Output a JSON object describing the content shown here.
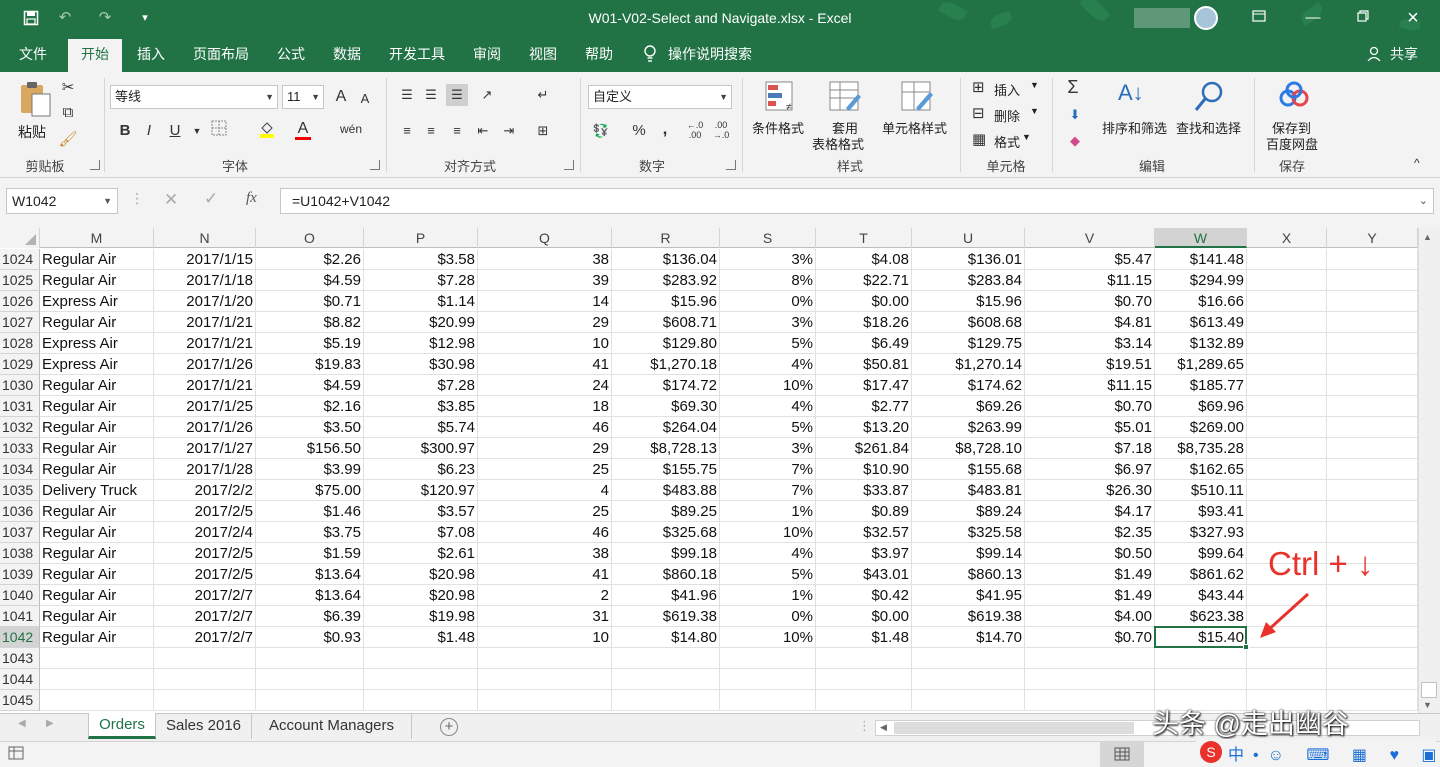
{
  "titlebar": {
    "doc_title": "W01-V02-Select and Navigate.xlsx  -  Excel",
    "save_icon": "save-icon",
    "undo_icon": "undo-icon",
    "redo_icon": "redo-icon",
    "restore_icon": "restore-icon"
  },
  "ribbon_tabs": [
    "文件",
    "开始",
    "插入",
    "页面布局",
    "公式",
    "数据",
    "开发工具",
    "审阅",
    "视图",
    "帮助",
    "操作说明搜索"
  ],
  "share_label": "共享",
  "clipboard": {
    "paste": "粘贴",
    "group": "剪贴板"
  },
  "font": {
    "name": "等线",
    "size": "11",
    "group": "字体",
    "bold": "B",
    "italic": "I",
    "underline": "U",
    "grow": "A",
    "shrink": "A"
  },
  "alignment": {
    "group": "对齐方式"
  },
  "number": {
    "format": "自定义",
    "group": "数字",
    "percent": "%",
    "comma": ","
  },
  "styles": {
    "conditional": "条件格式",
    "table_line1": "套用",
    "table_line2": "表格格式",
    "cell_styles": "单元格样式",
    "group": "样式"
  },
  "cells": {
    "insert": "插入",
    "delete": "删除",
    "format": "格式",
    "group": "单元格"
  },
  "editing": {
    "sort": "排序和筛选",
    "find": "查找和选择",
    "group": "编辑",
    "sum": "Σ"
  },
  "save_group": {
    "line1": "保存到",
    "line2": "百度网盘",
    "group": "保存"
  },
  "formula_bar": {
    "name_box": "W1042",
    "formula": "=U1042+V1042",
    "fx": "fx"
  },
  "columns": [
    "M",
    "N",
    "O",
    "P",
    "Q",
    "R",
    "S",
    "T",
    "U",
    "V",
    "W",
    "X",
    "Y"
  ],
  "rows": [
    {
      "num": "1024",
      "M": "Regular Air",
      "N": "2017/1/15",
      "O": "$2.26",
      "P": "$3.58",
      "Q": "38",
      "R": "$136.04",
      "S": "3%",
      "T": "$4.08",
      "U": "$136.01",
      "V": "$5.47",
      "W": "$141.48"
    },
    {
      "num": "1025",
      "M": "Regular Air",
      "N": "2017/1/18",
      "O": "$4.59",
      "P": "$7.28",
      "Q": "39",
      "R": "$283.92",
      "S": "8%",
      "T": "$22.71",
      "U": "$283.84",
      "V": "$11.15",
      "W": "$294.99"
    },
    {
      "num": "1026",
      "M": "Express Air",
      "N": "2017/1/20",
      "O": "$0.71",
      "P": "$1.14",
      "Q": "14",
      "R": "$15.96",
      "S": "0%",
      "T": "$0.00",
      "U": "$15.96",
      "V": "$0.70",
      "W": "$16.66"
    },
    {
      "num": "1027",
      "M": "Regular Air",
      "N": "2017/1/21",
      "O": "$8.82",
      "P": "$20.99",
      "Q": "29",
      "R": "$608.71",
      "S": "3%",
      "T": "$18.26",
      "U": "$608.68",
      "V": "$4.81",
      "W": "$613.49"
    },
    {
      "num": "1028",
      "M": "Express Air",
      "N": "2017/1/21",
      "O": "$5.19",
      "P": "$12.98",
      "Q": "10",
      "R": "$129.80",
      "S": "5%",
      "T": "$6.49",
      "U": "$129.75",
      "V": "$3.14",
      "W": "$132.89"
    },
    {
      "num": "1029",
      "M": "Express Air",
      "N": "2017/1/26",
      "O": "$19.83",
      "P": "$30.98",
      "Q": "41",
      "R": "$1,270.18",
      "S": "4%",
      "T": "$50.81",
      "U": "$1,270.14",
      "V": "$19.51",
      "W": "$1,289.65"
    },
    {
      "num": "1030",
      "M": "Regular Air",
      "N": "2017/1/21",
      "O": "$4.59",
      "P": "$7.28",
      "Q": "24",
      "R": "$174.72",
      "S": "10%",
      "T": "$17.47",
      "U": "$174.62",
      "V": "$11.15",
      "W": "$185.77"
    },
    {
      "num": "1031",
      "M": "Regular Air",
      "N": "2017/1/25",
      "O": "$2.16",
      "P": "$3.85",
      "Q": "18",
      "R": "$69.30",
      "S": "4%",
      "T": "$2.77",
      "U": "$69.26",
      "V": "$0.70",
      "W": "$69.96"
    },
    {
      "num": "1032",
      "M": "Regular Air",
      "N": "2017/1/26",
      "O": "$3.50",
      "P": "$5.74",
      "Q": "46",
      "R": "$264.04",
      "S": "5%",
      "T": "$13.20",
      "U": "$263.99",
      "V": "$5.01",
      "W": "$269.00"
    },
    {
      "num": "1033",
      "M": "Regular Air",
      "N": "2017/1/27",
      "O": "$156.50",
      "P": "$300.97",
      "Q": "29",
      "R": "$8,728.13",
      "S": "3%",
      "T": "$261.84",
      "U": "$8,728.10",
      "V": "$7.18",
      "W": "$8,735.28"
    },
    {
      "num": "1034",
      "M": "Regular Air",
      "N": "2017/1/28",
      "O": "$3.99",
      "P": "$6.23",
      "Q": "25",
      "R": "$155.75",
      "S": "7%",
      "T": "$10.90",
      "U": "$155.68",
      "V": "$6.97",
      "W": "$162.65"
    },
    {
      "num": "1035",
      "M": "Delivery Truck",
      "N": "2017/2/2",
      "O": "$75.00",
      "P": "$120.97",
      "Q": "4",
      "R": "$483.88",
      "S": "7%",
      "T": "$33.87",
      "U": "$483.81",
      "V": "$26.30",
      "W": "$510.11"
    },
    {
      "num": "1036",
      "M": "Regular Air",
      "N": "2017/2/5",
      "O": "$1.46",
      "P": "$3.57",
      "Q": "25",
      "R": "$89.25",
      "S": "1%",
      "T": "$0.89",
      "U": "$89.24",
      "V": "$4.17",
      "W": "$93.41"
    },
    {
      "num": "1037",
      "M": "Regular Air",
      "N": "2017/2/4",
      "O": "$3.75",
      "P": "$7.08",
      "Q": "46",
      "R": "$325.68",
      "S": "10%",
      "T": "$32.57",
      "U": "$325.58",
      "V": "$2.35",
      "W": "$327.93"
    },
    {
      "num": "1038",
      "M": "Regular Air",
      "N": "2017/2/5",
      "O": "$1.59",
      "P": "$2.61",
      "Q": "38",
      "R": "$99.18",
      "S": "4%",
      "T": "$3.97",
      "U": "$99.14",
      "V": "$0.50",
      "W": "$99.64"
    },
    {
      "num": "1039",
      "M": "Regular Air",
      "N": "2017/2/5",
      "O": "$13.64",
      "P": "$20.98",
      "Q": "41",
      "R": "$860.18",
      "S": "5%",
      "T": "$43.01",
      "U": "$860.13",
      "V": "$1.49",
      "W": "$861.62"
    },
    {
      "num": "1040",
      "M": "Regular Air",
      "N": "2017/2/7",
      "O": "$13.64",
      "P": "$20.98",
      "Q": "2",
      "R": "$41.96",
      "S": "1%",
      "T": "$0.42",
      "U": "$41.95",
      "V": "$1.49",
      "W": "$43.44"
    },
    {
      "num": "1041",
      "M": "Regular Air",
      "N": "2017/2/7",
      "O": "$6.39",
      "P": "$19.98",
      "Q": "31",
      "R": "$619.38",
      "S": "0%",
      "T": "$0.00",
      "U": "$619.38",
      "V": "$4.00",
      "W": "$623.38"
    },
    {
      "num": "1042",
      "M": "Regular Air",
      "N": "2017/2/7",
      "O": "$0.93",
      "P": "$1.48",
      "Q": "10",
      "R": "$14.80",
      "S": "10%",
      "T": "$1.48",
      "U": "$14.70",
      "V": "$0.70",
      "W": "$15.40"
    },
    {
      "num": "1043"
    },
    {
      "num": "1044"
    },
    {
      "num": "1045"
    }
  ],
  "annotation": "Ctrl + ↓",
  "sheet_tabs": [
    "Orders",
    "Sales 2016",
    "Account Managers"
  ],
  "watermark": "头条 @走出幽谷",
  "colors": {
    "excel_green": "#217346",
    "annotation_red": "#e8322b"
  }
}
